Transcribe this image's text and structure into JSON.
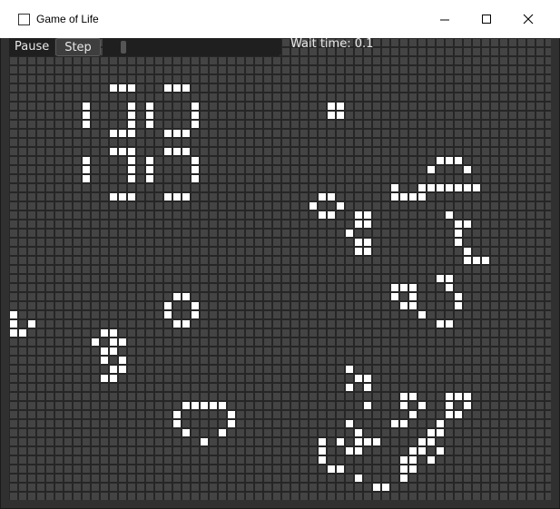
{
  "window": {
    "title": "Game of Life"
  },
  "toolbar": {
    "pause_label": "Pause",
    "step_label": "Step",
    "wait_label": "Wait time: 0.1",
    "wait_slider_value": 0.1
  },
  "colors": {
    "grid_line": "#262626",
    "dead_cell": "#444444",
    "live_cell": "#ffffff"
  },
  "board": {
    "columns": 60,
    "rows": 51,
    "live_cells": [
      [
        11,
        5
      ],
      [
        12,
        5
      ],
      [
        13,
        5
      ],
      [
        17,
        5
      ],
      [
        18,
        5
      ],
      [
        19,
        5
      ],
      [
        8,
        7
      ],
      [
        13,
        7
      ],
      [
        15,
        7
      ],
      [
        20,
        7
      ],
      [
        35,
        7
      ],
      [
        36,
        7
      ],
      [
        8,
        8
      ],
      [
        13,
        8
      ],
      [
        15,
        8
      ],
      [
        20,
        8
      ],
      [
        35,
        8
      ],
      [
        36,
        8
      ],
      [
        8,
        9
      ],
      [
        13,
        9
      ],
      [
        15,
        9
      ],
      [
        20,
        9
      ],
      [
        11,
        10
      ],
      [
        12,
        10
      ],
      [
        13,
        10
      ],
      [
        17,
        10
      ],
      [
        18,
        10
      ],
      [
        19,
        10
      ],
      [
        11,
        12
      ],
      [
        12,
        12
      ],
      [
        13,
        12
      ],
      [
        17,
        12
      ],
      [
        18,
        12
      ],
      [
        19,
        12
      ],
      [
        8,
        13
      ],
      [
        13,
        13
      ],
      [
        15,
        13
      ],
      [
        20,
        13
      ],
      [
        47,
        13
      ],
      [
        48,
        13
      ],
      [
        49,
        13
      ],
      [
        8,
        14
      ],
      [
        13,
        14
      ],
      [
        15,
        14
      ],
      [
        20,
        14
      ],
      [
        46,
        14
      ],
      [
        50,
        14
      ],
      [
        8,
        15
      ],
      [
        13,
        15
      ],
      [
        15,
        15
      ],
      [
        20,
        15
      ],
      [
        42,
        16
      ],
      [
        45,
        16
      ],
      [
        46,
        16
      ],
      [
        47,
        16
      ],
      [
        48,
        16
      ],
      [
        49,
        16
      ],
      [
        50,
        16
      ],
      [
        51,
        16
      ],
      [
        11,
        17
      ],
      [
        12,
        17
      ],
      [
        13,
        17
      ],
      [
        17,
        17
      ],
      [
        18,
        17
      ],
      [
        19,
        17
      ],
      [
        34,
        17
      ],
      [
        35,
        17
      ],
      [
        42,
        17
      ],
      [
        43,
        17
      ],
      [
        44,
        17
      ],
      [
        45,
        17
      ],
      [
        33,
        18
      ],
      [
        36,
        18
      ],
      [
        34,
        19
      ],
      [
        35,
        19
      ],
      [
        38,
        19
      ],
      [
        39,
        19
      ],
      [
        48,
        19
      ],
      [
        38,
        20
      ],
      [
        39,
        20
      ],
      [
        49,
        20
      ],
      [
        50,
        20
      ],
      [
        37,
        21
      ],
      [
        49,
        21
      ],
      [
        38,
        22
      ],
      [
        39,
        22
      ],
      [
        49,
        22
      ],
      [
        38,
        23
      ],
      [
        39,
        23
      ],
      [
        50,
        23
      ],
      [
        50,
        24
      ],
      [
        51,
        24
      ],
      [
        52,
        24
      ],
      [
        47,
        26
      ],
      [
        48,
        26
      ],
      [
        42,
        27
      ],
      [
        43,
        27
      ],
      [
        44,
        27
      ],
      [
        48,
        27
      ],
      [
        18,
        28
      ],
      [
        19,
        28
      ],
      [
        42,
        28
      ],
      [
        44,
        28
      ],
      [
        49,
        28
      ],
      [
        17,
        29
      ],
      [
        20,
        29
      ],
      [
        43,
        29
      ],
      [
        44,
        29
      ],
      [
        49,
        29
      ],
      [
        0,
        30
      ],
      [
        17,
        30
      ],
      [
        20,
        30
      ],
      [
        45,
        30
      ],
      [
        0,
        31
      ],
      [
        2,
        31
      ],
      [
        18,
        31
      ],
      [
        19,
        31
      ],
      [
        47,
        31
      ],
      [
        48,
        31
      ],
      [
        0,
        32
      ],
      [
        1,
        32
      ],
      [
        10,
        32
      ],
      [
        11,
        32
      ],
      [
        9,
        33
      ],
      [
        11,
        33
      ],
      [
        12,
        33
      ],
      [
        10,
        34
      ],
      [
        11,
        34
      ],
      [
        10,
        35
      ],
      [
        12,
        35
      ],
      [
        37,
        36
      ],
      [
        11,
        36
      ],
      [
        12,
        36
      ],
      [
        10,
        37
      ],
      [
        11,
        37
      ],
      [
        38,
        37
      ],
      [
        39,
        37
      ],
      [
        37,
        38
      ],
      [
        39,
        38
      ],
      [
        43,
        39
      ],
      [
        44,
        39
      ],
      [
        48,
        39
      ],
      [
        49,
        39
      ],
      [
        50,
        39
      ],
      [
        19,
        40
      ],
      [
        20,
        40
      ],
      [
        21,
        40
      ],
      [
        22,
        40
      ],
      [
        23,
        40
      ],
      [
        39,
        40
      ],
      [
        43,
        40
      ],
      [
        45,
        40
      ],
      [
        48,
        40
      ],
      [
        50,
        40
      ],
      [
        18,
        41
      ],
      [
        24,
        41
      ],
      [
        44,
        41
      ],
      [
        48,
        41
      ],
      [
        49,
        41
      ],
      [
        18,
        42
      ],
      [
        24,
        42
      ],
      [
        37,
        42
      ],
      [
        42,
        42
      ],
      [
        43,
        42
      ],
      [
        47,
        42
      ],
      [
        19,
        43
      ],
      [
        23,
        43
      ],
      [
        38,
        43
      ],
      [
        46,
        43
      ],
      [
        47,
        43
      ],
      [
        34,
        44
      ],
      [
        36,
        44
      ],
      [
        21,
        44
      ],
      [
        38,
        44
      ],
      [
        39,
        44
      ],
      [
        40,
        44
      ],
      [
        45,
        44
      ],
      [
        46,
        44
      ],
      [
        34,
        45
      ],
      [
        37,
        45
      ],
      [
        38,
        45
      ],
      [
        44,
        45
      ],
      [
        45,
        45
      ],
      [
        47,
        45
      ],
      [
        34,
        46
      ],
      [
        43,
        46
      ],
      [
        44,
        46
      ],
      [
        46,
        46
      ],
      [
        35,
        47
      ],
      [
        36,
        47
      ],
      [
        43,
        47
      ],
      [
        44,
        47
      ],
      [
        38,
        48
      ],
      [
        43,
        48
      ],
      [
        40,
        49
      ],
      [
        41,
        49
      ]
    ]
  }
}
